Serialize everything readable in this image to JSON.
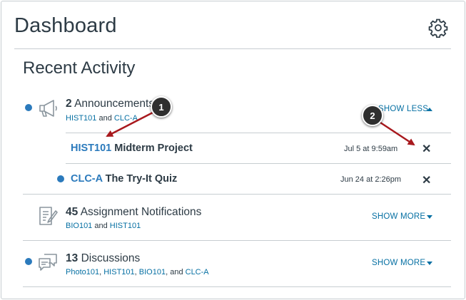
{
  "header": {
    "title": "Dashboard",
    "settings_icon": "gear-icon"
  },
  "recent_activity": {
    "title": "Recent Activity",
    "groups": [
      {
        "count": "2",
        "label": "Announcements",
        "icon": "megaphone-icon",
        "courses": [
          "HIST101",
          "CLC-A"
        ],
        "toggle": "SHOW LESS",
        "unread": true,
        "items": [
          {
            "code": "HIST101",
            "name": "Midterm Project",
            "date": "Jul 5 at 9:59am",
            "unread": false
          },
          {
            "code": "CLC-A",
            "name": "The Try-It Quiz",
            "date": "Jun 24 at 2:26pm",
            "unread": true
          }
        ]
      },
      {
        "count": "45",
        "label": "Assignment Notifications",
        "icon": "assignment-icon",
        "courses": [
          "BIO101",
          "HIST101"
        ],
        "toggle": "SHOW MORE",
        "unread": false
      },
      {
        "count": "13",
        "label": "Discussions",
        "icon": "discussion-icon",
        "courses": [
          "Photo101",
          "HIST101",
          "BIO101",
          "CLC-A"
        ],
        "toggle": "SHOW MORE",
        "unread": true
      }
    ],
    "and_word": "and",
    "and_word_serial": ", and"
  },
  "callouts": [
    "1",
    "2"
  ],
  "colors": {
    "accent": "#2b7abc",
    "link": "#0770a3",
    "text": "#2d3b45",
    "callout_arrow": "#a8191e"
  }
}
